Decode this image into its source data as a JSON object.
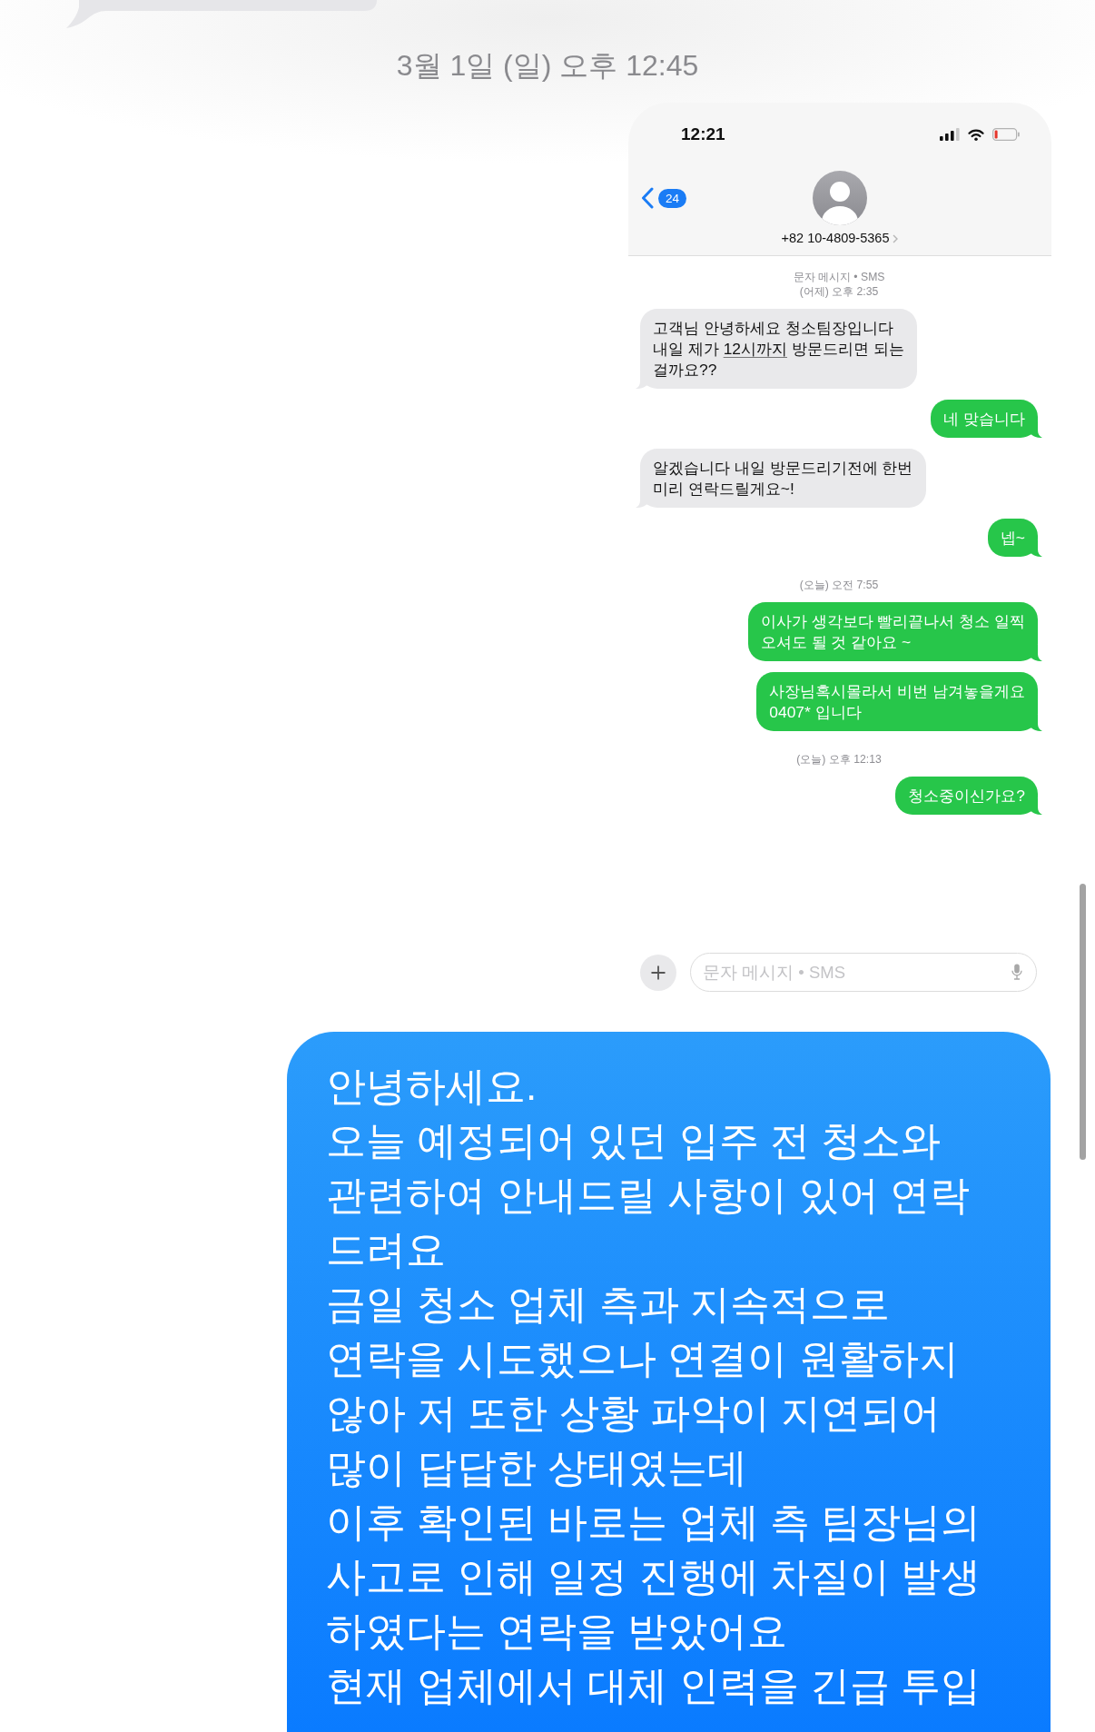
{
  "timestamp": "3월 1일 (일) 오후 12:45",
  "screenshot": {
    "status_bar": {
      "time": "12:21"
    },
    "header": {
      "unread_count": "24",
      "contact": "+82 10-4809-5365"
    },
    "items": [
      {
        "kind": "label",
        "text": "문자 메시지 • SMS"
      },
      {
        "kind": "label",
        "text": "(어제) 오후 2:35"
      },
      {
        "kind": "received",
        "segments": [
          {
            "kind": "plain",
            "text": "고객님 안녕하세요 청소팀장입니다\n내일 제가 "
          },
          {
            "kind": "link",
            "text": "12시까지"
          },
          {
            "kind": "plain",
            "text": " 방문드리면 되는\n걸까요??"
          }
        ]
      },
      {
        "kind": "sent",
        "text": "네 맞습니다"
      },
      {
        "kind": "received",
        "text": "알겠습니다 내일 방문드리기전에 한번\n미리 연락드릴게요~!"
      },
      {
        "kind": "sent",
        "text": "넵~"
      },
      {
        "kind": "label",
        "text": "(오늘) 오전 7:55"
      },
      {
        "kind": "sent",
        "text": "이사가 생각보다 빨리끝나서 청소 일찍\n오셔도 될 것 같아요 ~"
      },
      {
        "kind": "sent",
        "text": "사장님혹시몰라서 비번 남겨놓을게요\n0407* 입니다"
      },
      {
        "kind": "label",
        "text": "(오늘) 오후 12:13"
      },
      {
        "kind": "sent",
        "text": "청소중이신가요?"
      }
    ],
    "composer": {
      "placeholder": "문자 메시지 • SMS"
    }
  },
  "message": {
    "text": "안녕하세요.\n오늘 예정되어 있던 입주 전 청소와\n관련하여 안내드릴 사항이 있어 연락\n드려요\n금일 청소 업체 측과 지속적으로\n연락을 시도했으나 연결이 원활하지\n않아 저 또한 상황 파악이 지연되어\n많이 답답한 상태였는데\n이후 확인된 바로는 업체 측 팀장님의\n사고로 인해 일정 진행에 차질이 발생\n하였다는 연락을 받았어요\n현재 업체에서 대체 인력을 긴급 투입"
  }
}
